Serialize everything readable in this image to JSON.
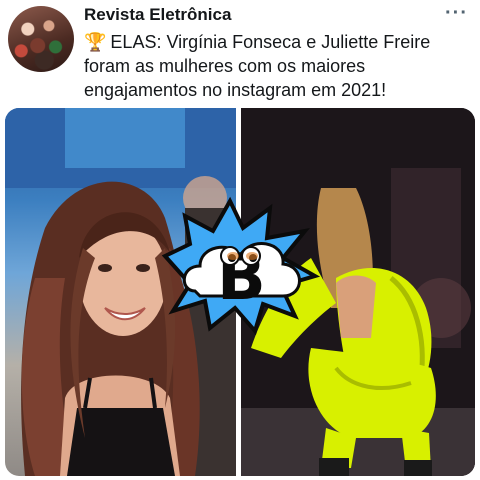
{
  "tweet": {
    "author_name": "Revista Eletrônica",
    "more_icon": "more-horizontal-icon",
    "more_glyph": "···",
    "trophy_glyph": "🏆",
    "text": "ELAS: Virgínia Fonseca e Juliette Freire foram as mulheres com os maiores engajamentos no instagram em 2021!"
  },
  "sticker": {
    "letter": "B"
  },
  "colors": {
    "text": "#14171a",
    "muted": "#536471",
    "neon": "#d8f000",
    "sticker_blue": "#3fa9f5"
  }
}
